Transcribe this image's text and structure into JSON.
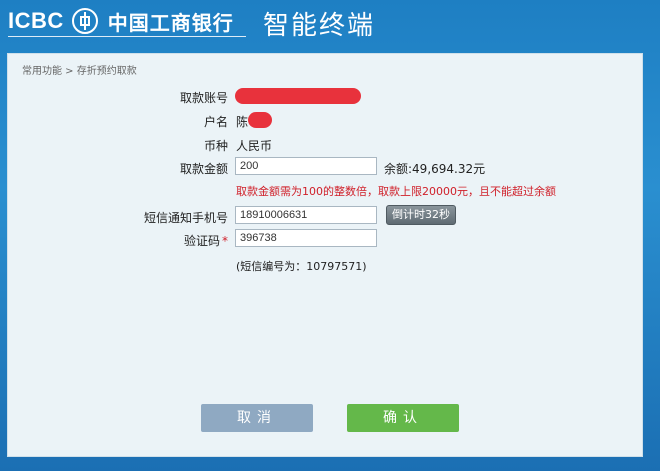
{
  "header": {
    "logo_text": "ICBC",
    "bank_name": "中国工商银行",
    "terminal_title": "智能终端"
  },
  "breadcrumb": "常用功能 > 存折预约取款",
  "form": {
    "account": {
      "label": "取款账号"
    },
    "name": {
      "label": "户名",
      "value_prefix": "陈"
    },
    "currency": {
      "label": "币种",
      "value": "人民币"
    },
    "amount": {
      "label": "取款金额",
      "value": "200",
      "balance": "余额:49,694.32元"
    },
    "amount_warning": "取款金额需为100的整数倍，取款上限20000元，且不能超过余额",
    "phone": {
      "label": "短信通知手机号",
      "value": "18910006631",
      "countdown_label": "倒计时32秒"
    },
    "code": {
      "label": "验证码",
      "required_mark": "*",
      "value": "396738"
    },
    "sms_note": "(短信编号为：10797571)"
  },
  "buttons": {
    "cancel_label": "取消",
    "confirm_label": "确认"
  },
  "colors": {
    "background": "#1e7fc3",
    "panel": "#ebf3f7",
    "warning": "#d0202a",
    "redaction": "#e8323c",
    "confirm": "#64b84a",
    "cancel": "#8fa9c2"
  }
}
